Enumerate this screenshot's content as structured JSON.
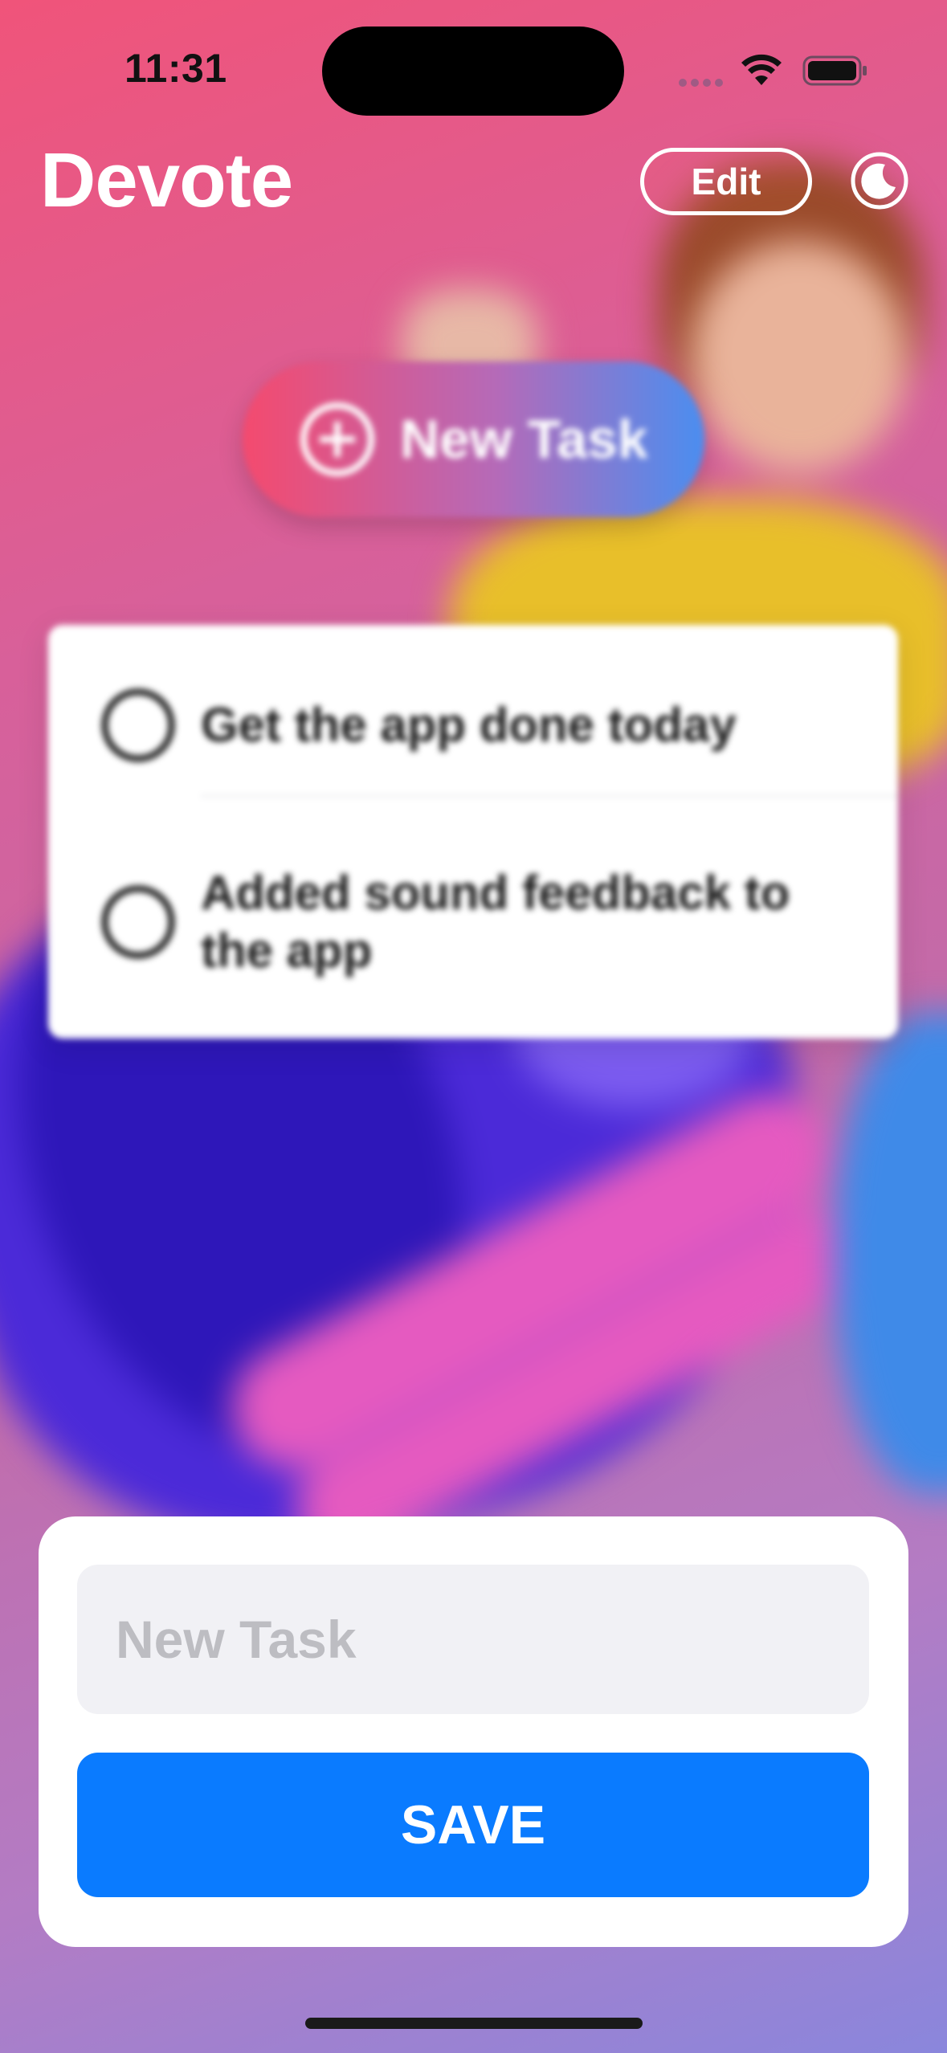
{
  "status_bar": {
    "time": "11:31",
    "icons": [
      "cellular-icon",
      "wifi-icon",
      "battery-icon"
    ]
  },
  "header": {
    "title": "Devote",
    "edit_label": "Edit",
    "theme_toggle_icon": "moon-icon"
  },
  "new_task_button": {
    "label": "New Task",
    "icon": "plus-circle-icon",
    "gradient": [
      "#f44a6e",
      "#4a8ef0"
    ]
  },
  "tasks": [
    {
      "title": "Get the app done today",
      "completed": false
    },
    {
      "title": "Added sound feedback to the app",
      "completed": false
    }
  ],
  "sheet": {
    "input_placeholder": "New Task",
    "input_value": "",
    "save_label": "SAVE"
  },
  "colors": {
    "accent": "#0a7bff",
    "background_top": "#f0547a",
    "background_bottom": "#8a86dc"
  }
}
